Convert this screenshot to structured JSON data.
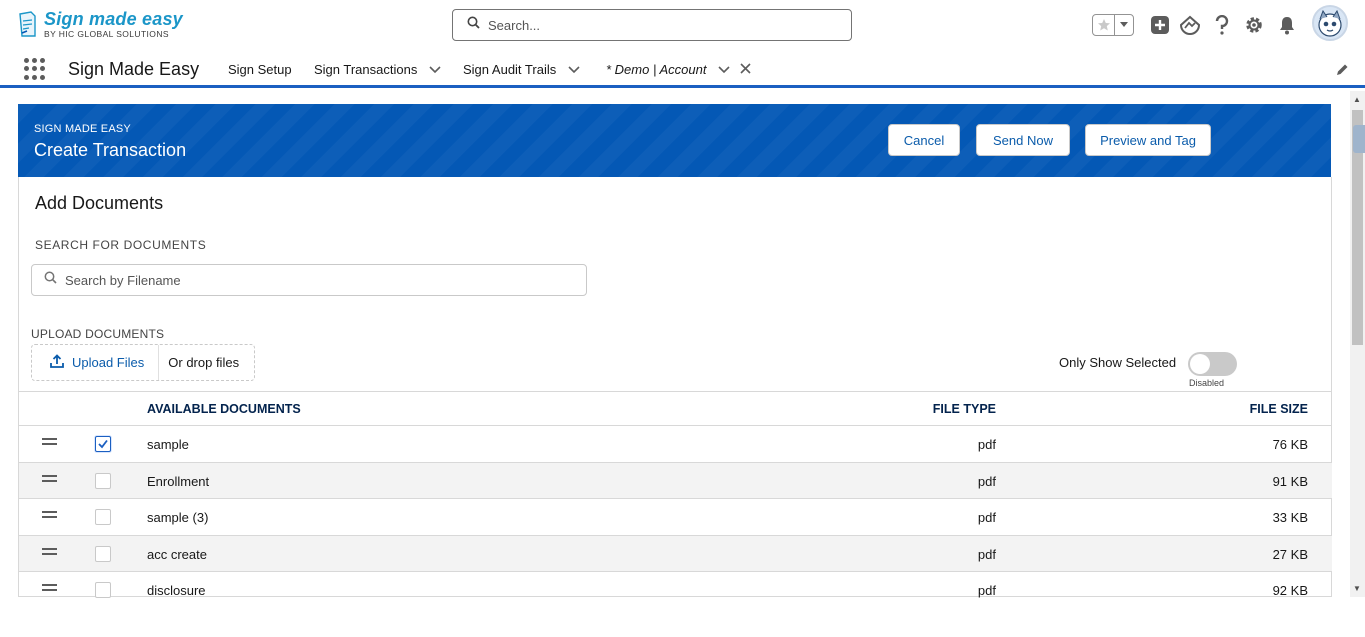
{
  "logo": {
    "title": "Sign made easy",
    "subtitle": "BY HIC GLOBAL SOLUTIONS"
  },
  "global_search": {
    "placeholder": "Search..."
  },
  "nav": {
    "app_name": "Sign Made Easy",
    "items": [
      {
        "label": "Sign Setup"
      },
      {
        "label": "Sign Transactions"
      },
      {
        "label": "Sign Audit Trails"
      },
      {
        "label": "* Demo | Account"
      }
    ]
  },
  "header": {
    "eyebrow": "SIGN MADE EASY",
    "title": "Create Transaction",
    "buttons": {
      "cancel": "Cancel",
      "send": "Send Now",
      "preview": "Preview and Tag"
    }
  },
  "card": {
    "title": "Add Documents",
    "search_label": "SEARCH FOR DOCUMENTS",
    "search_placeholder": "Search by Filename",
    "upload_label": "UPLOAD DOCUMENTS",
    "upload_button": "Upload Files",
    "drop_text": "Or drop files",
    "toggle_label": "Only Show Selected",
    "toggle_status": "Disabled",
    "toggle_on": false
  },
  "table": {
    "headers": {
      "name": "AVAILABLE DOCUMENTS",
      "type": "FILE TYPE",
      "size": "FILE SIZE"
    },
    "rows": [
      {
        "name": "sample",
        "type": "pdf",
        "size": "76 KB",
        "checked": true
      },
      {
        "name": "Enrollment",
        "type": "pdf",
        "size": "91 KB",
        "checked": false
      },
      {
        "name": "sample (3)",
        "type": "pdf",
        "size": "33 KB",
        "checked": false
      },
      {
        "name": "acc create",
        "type": "pdf",
        "size": "27 KB",
        "checked": false
      },
      {
        "name": "disclosure",
        "type": "pdf",
        "size": "92 KB",
        "checked": false
      }
    ]
  },
  "colors": {
    "brand_blue": "#0458b5",
    "link_blue": "#0b5cab",
    "nav_accent": "#1b5fc1"
  }
}
